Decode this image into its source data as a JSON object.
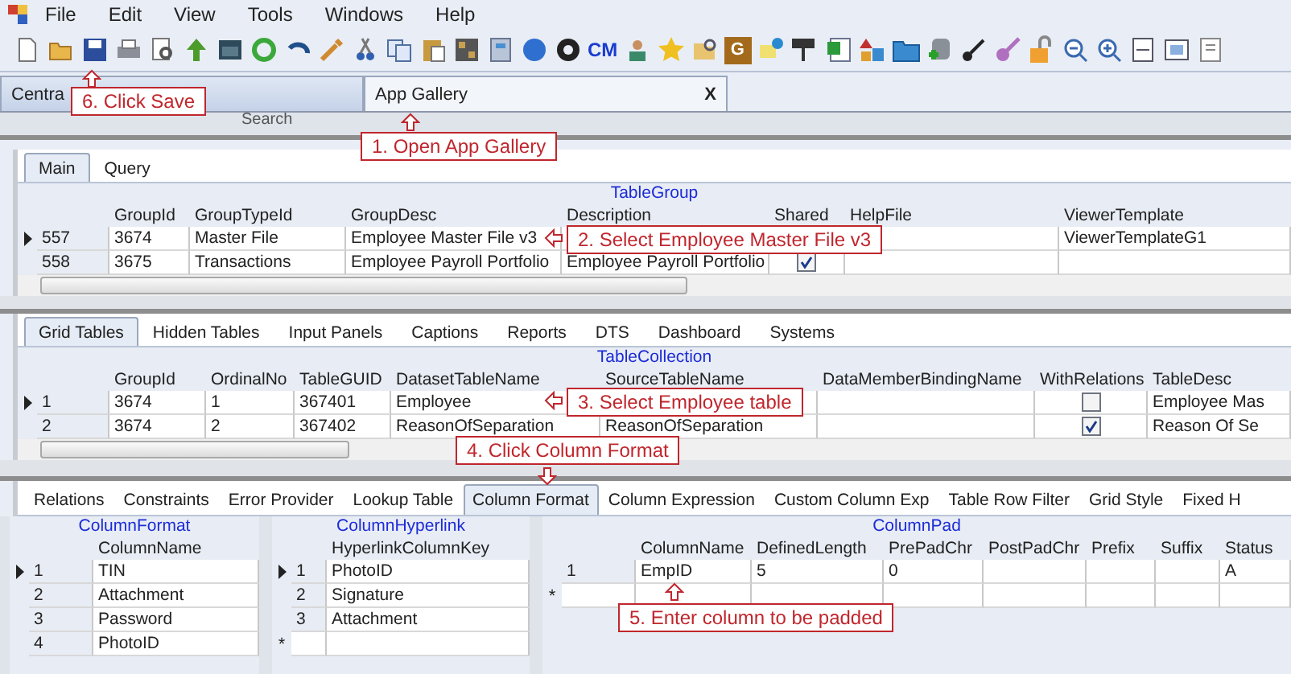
{
  "menu": [
    "File",
    "Edit",
    "View",
    "Tools",
    "Windows",
    "Help"
  ],
  "toolbar": {
    "cm_logo": "CM",
    "g_label": "G"
  },
  "doc_tabs": [
    {
      "label": "Centra",
      "selected": false,
      "closable": false
    },
    {
      "label": "App Gallery",
      "selected": true,
      "closable": true
    }
  ],
  "close_glyph": "X",
  "search_label": "Search",
  "pane1": {
    "tabs": [
      {
        "label": "Main",
        "selected": true
      },
      {
        "label": "Query",
        "selected": false
      }
    ],
    "grid": {
      "title": "TableGroup",
      "columns": [
        null,
        "GroupId",
        "GroupTypeId",
        "GroupDesc",
        "Description",
        "Shared",
        "HelpFile",
        "ViewerTemplate"
      ],
      "rows": [
        {
          "current": true,
          "cells": [
            "557",
            "3674",
            "Master File",
            "Employee Master File v3",
            null,
            null,
            null,
            "ViewerTemplateG1"
          ]
        },
        {
          "current": false,
          "cells": [
            "558",
            "3675",
            "Transactions",
            "Employee Payroll Portfolio",
            "Employee Payroll Portfolio",
            {
              "checked": true
            },
            null,
            null
          ]
        }
      ]
    }
  },
  "pane2": {
    "tabs": [
      {
        "label": "Grid Tables",
        "selected": true
      },
      {
        "label": "Hidden Tables",
        "selected": false
      },
      {
        "label": "Input Panels",
        "selected": false
      },
      {
        "label": "Captions",
        "selected": false
      },
      {
        "label": "Reports",
        "selected": false
      },
      {
        "label": "DTS",
        "selected": false
      },
      {
        "label": "Dashboard",
        "selected": false
      },
      {
        "label": "Systems",
        "selected": false
      }
    ],
    "grid": {
      "title": "TableCollection",
      "columns": [
        null,
        "GroupId",
        "OrdinalNo",
        "TableGUID",
        "DatasetTableName",
        "SourceTableName",
        "DataMemberBindingName",
        "WithRelations",
        "TableDesc"
      ],
      "rows": [
        {
          "current": true,
          "cells": [
            "1",
            "3674",
            "1",
            "367401",
            "Employee",
            null,
            null,
            {
              "checked": false
            },
            "Employee Mas"
          ]
        },
        {
          "current": false,
          "cells": [
            "2",
            "3674",
            "2",
            "367402",
            "ReasonOfSeparation",
            "ReasonOfSeparation",
            null,
            {
              "checked": true
            },
            "Reason Of Se"
          ]
        }
      ]
    }
  },
  "pane3": {
    "tabs": [
      {
        "label": "Relations",
        "selected": false
      },
      {
        "label": "Constraints",
        "selected": false
      },
      {
        "label": "Error Provider",
        "selected": false
      },
      {
        "label": "Lookup Table",
        "selected": false
      },
      {
        "label": "Column Format",
        "selected": true
      },
      {
        "label": "Column Expression",
        "selected": false
      },
      {
        "label": "Custom Column Exp",
        "selected": false
      },
      {
        "label": "Table Row Filter",
        "selected": false
      },
      {
        "label": "Grid Style",
        "selected": false
      },
      {
        "label": "Fixed H",
        "selected": false
      }
    ],
    "grids": [
      {
        "title": "ColumnFormat",
        "columns": [
          null,
          "ColumnName"
        ],
        "rows": [
          {
            "current": true,
            "cells": [
              "1",
              "TIN"
            ]
          },
          {
            "current": false,
            "cells": [
              "2",
              "Attachment"
            ]
          },
          {
            "current": false,
            "cells": [
              "3",
              "Password"
            ]
          },
          {
            "current": false,
            "cells": [
              "4",
              "PhotoID"
            ]
          }
        ]
      },
      {
        "title": "ColumnHyperlink",
        "columns": [
          null,
          "HyperlinkColumnKey"
        ],
        "rows": [
          {
            "current": true,
            "cells": [
              "1",
              "PhotoID"
            ]
          },
          {
            "current": false,
            "cells": [
              "2",
              "Signature"
            ]
          },
          {
            "current": false,
            "cells": [
              "3",
              "Attachment"
            ]
          }
        ],
        "new_row_marker": "*"
      },
      {
        "title": "ColumnPad",
        "columns": [
          null,
          "ColumnName",
          "DefinedLength",
          "PrePadChr",
          "PostPadChr",
          "Prefix",
          "Suffix",
          "Status"
        ],
        "rows": [
          {
            "current": false,
            "cells": [
              "1",
              "EmpID",
              "5",
              "0",
              null,
              null,
              null,
              "A"
            ]
          }
        ],
        "new_row_marker": "*"
      }
    ]
  },
  "callouts": [
    "6. Click Save",
    "1. Open App Gallery",
    "2. Select Employee Master File v3",
    "3. Select Employee table",
    "4. Click Column Format",
    "5. Enter column to be padded"
  ]
}
